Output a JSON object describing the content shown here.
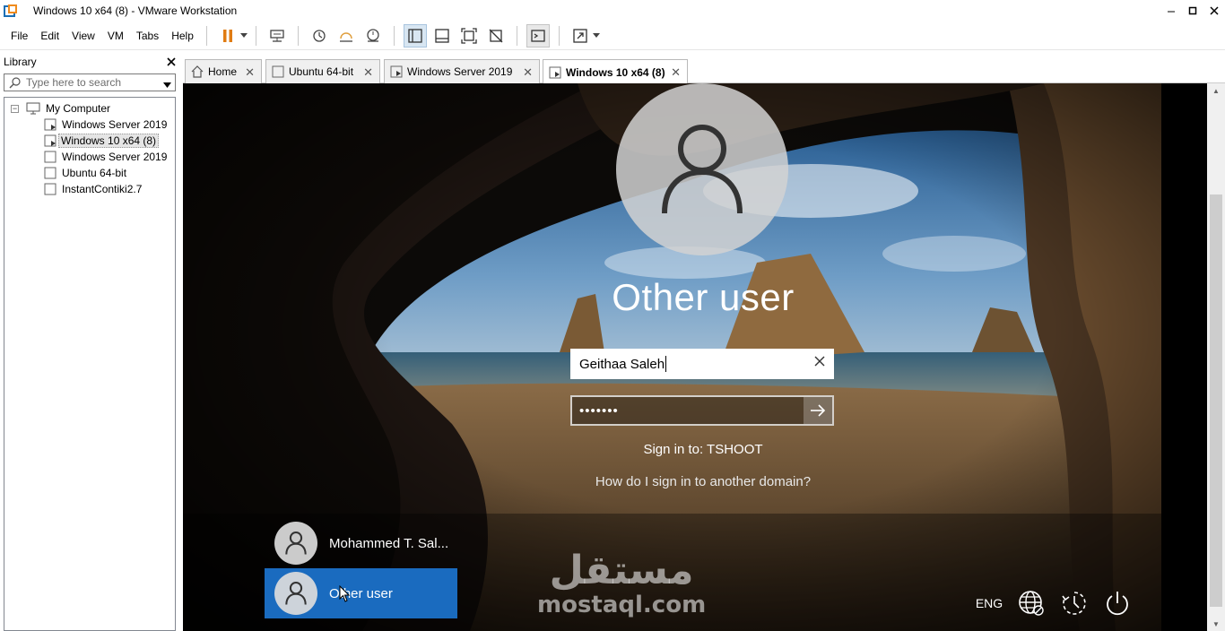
{
  "window": {
    "title": "Windows 10 x64 (8) - VMware Workstation",
    "controls": [
      "minimize",
      "maximize",
      "close"
    ]
  },
  "menu": {
    "items": [
      "File",
      "Edit",
      "View",
      "VM",
      "Tabs",
      "Help"
    ]
  },
  "library": {
    "title": "Library",
    "search_placeholder": "Type here to search",
    "root": "My Computer",
    "items": [
      {
        "label": "Windows Server 2019"
      },
      {
        "label": "Windows 10 x64 (8)",
        "selected": true
      },
      {
        "label": "Windows Server 2019"
      },
      {
        "label": "Ubuntu 64-bit"
      },
      {
        "label": "InstantContiki2.7"
      }
    ]
  },
  "tabs": [
    {
      "label": "Home",
      "icon": "home-icon"
    },
    {
      "label": "Ubuntu 64-bit",
      "icon": "vm-icon"
    },
    {
      "label": "Windows Server 2019",
      "icon": "vm-running-icon"
    },
    {
      "label": "Windows 10 x64 (8)",
      "icon": "vm-running-icon",
      "active": true
    }
  ],
  "login": {
    "display_name": "Other user",
    "username_value": "Geithaa Saleh",
    "password_mask": "•••••••",
    "sign_in_to": "Sign in to: TSHOOT",
    "domain_help": "How do I sign in to another domain?"
  },
  "user_list": [
    {
      "name": "Mohammed T. Sal..."
    },
    {
      "name": "Other user",
      "selected": true
    }
  ],
  "tray": {
    "language": "ENG",
    "icons": [
      "network-icon",
      "ease-of-access-icon",
      "power-icon"
    ]
  },
  "watermark": {
    "arabic": "مستقل",
    "latin": "mostaql.com"
  },
  "colors": {
    "selected_tile": "#1a6bbf",
    "tab_border": "#b9b9b9"
  }
}
